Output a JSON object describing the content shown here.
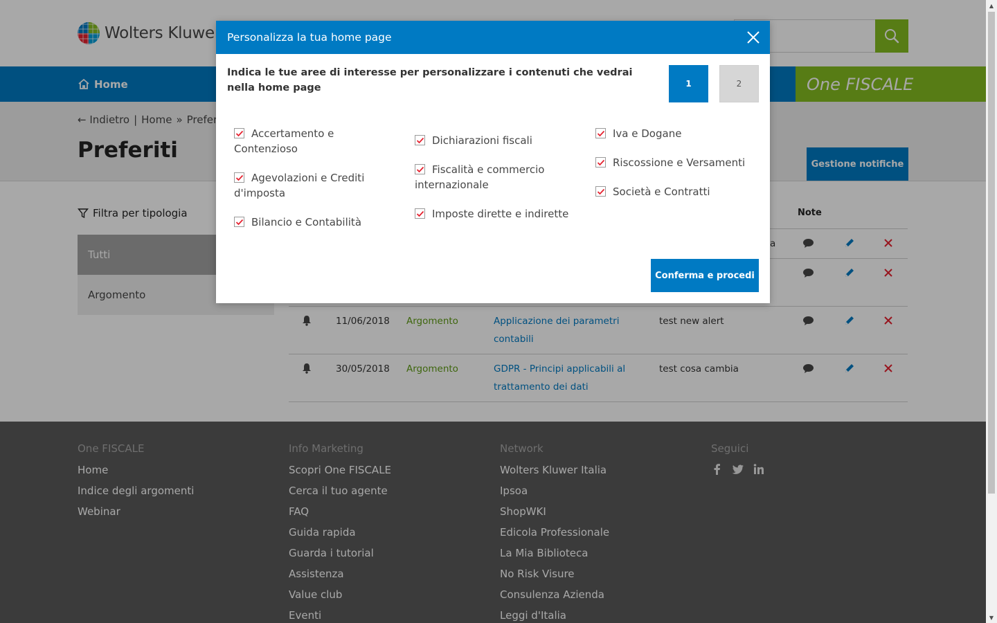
{
  "header": {
    "brand": "Wolters Kluwer"
  },
  "nav": {
    "home": "Home",
    "product": "One FISCALE"
  },
  "subhead": {
    "back": "← Indietro",
    "sep": "|",
    "crumb_home": "Home",
    "crumb_sep": "»",
    "crumb_current": "Preferiti",
    "title": "Preferiti",
    "notif_button": "Gestione notifiche"
  },
  "filters": {
    "label": "Filtra per tipologia",
    "items": [
      "Tutti",
      "Argomento"
    ]
  },
  "table": {
    "note_header": "Note",
    "row1_note_fragment": "a",
    "rows": [
      {
        "date": "11/06/2018",
        "type": "Argomento",
        "title": "Applicazione dei parametri contabili",
        "note": "test new alert"
      },
      {
        "date": "30/05/2018",
        "type": "Argomento",
        "title": "GDPR - Principi applicabili al trattamento dei dati",
        "note": "test cosa cambia"
      }
    ]
  },
  "footer": {
    "col1": {
      "head": "One FISCALE",
      "links": [
        "Home",
        "Indice degli argomenti",
        "Webinar"
      ]
    },
    "col2": {
      "head": "Info Marketing",
      "links": [
        "Scopri One FISCALE",
        "Cerca il tuo agente",
        "FAQ",
        "Guida rapida",
        "Guarda i tutorial",
        "Assistenza",
        "Value club",
        "Eventi"
      ]
    },
    "col3": {
      "head": "Network",
      "links": [
        "Wolters Kluwer Italia",
        "Ipsoa",
        "ShopWKI",
        "Edicola Professionale",
        "La Mia Biblioteca",
        "No Risk Visure",
        "Consulenza Azienda",
        "Leggi d'Italia"
      ]
    },
    "col4": {
      "head": "Seguici"
    }
  },
  "modal": {
    "title": "Personalizza la tua home page",
    "intro": "Indica le tue aree di interesse per personalizzare i contenuti che vedrai nella home page",
    "step1": "1",
    "step2": "2",
    "options": [
      "Accertamento e Contenzioso",
      "Agevolazioni e Crediti d'imposta",
      "Bilancio e Contabilità",
      "Dichiarazioni fiscali",
      "Fiscalità e commercio internazionale",
      "Imposte dirette e indirette",
      "Iva e Dogane",
      "Riscossione e Versamenti",
      "Società e Contratti"
    ],
    "confirm": "Conferma e procedi"
  },
  "colors": {
    "primary": "#007ac3",
    "green": "#85bc20",
    "red": "#e5202e",
    "footer": "#5a5a5a"
  }
}
